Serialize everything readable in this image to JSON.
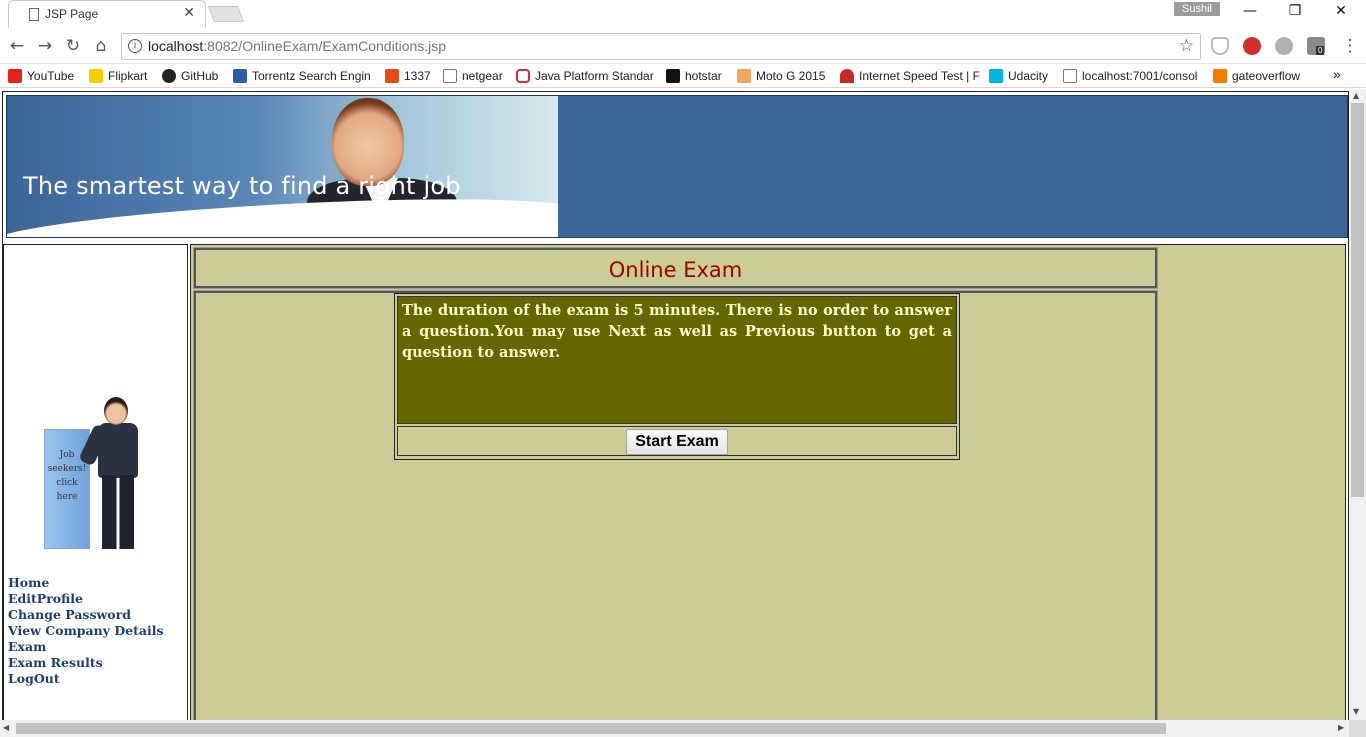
{
  "browser": {
    "tab_title": "JSP Page",
    "tab_close": "✕",
    "user_name": "Sushil",
    "url_host": "localhost",
    "url_rest": ":8082/OnlineExam/ExamConditions.jsp",
    "info_glyph": "i",
    "star_glyph": "☆",
    "window_controls": {
      "minimize": "—",
      "restore": "❐",
      "close": "✕"
    },
    "nav": {
      "back": "←",
      "forward": "→",
      "reload": "↻",
      "home": "⌂",
      "menu": "⋮"
    },
    "extensions": [
      "shield-icon",
      "adblock-icon",
      "extension-icon",
      "extension-badge-icon"
    ],
    "extension_badge": "0",
    "bookmarks_more": "»"
  },
  "bookmarks": [
    {
      "label": "YouTube",
      "color": "#e62117"
    },
    {
      "label": "Flipkart",
      "color": "#f7d000"
    },
    {
      "label": "GitHub",
      "color": "#222222"
    },
    {
      "label": "Torrentz Search Engin",
      "color": "#2a5ca8"
    },
    {
      "label": "1337",
      "color": "#e64a19"
    },
    {
      "label": "netgear",
      "color": "#888888"
    },
    {
      "label": "Java Platform Standar",
      "color": "#d32f2f"
    },
    {
      "label": "hotstar",
      "color": "#111111"
    },
    {
      "label": "Moto G 2015",
      "color": "#f2a65a"
    },
    {
      "label": "Internet Speed Test | F",
      "color": "#c62828"
    },
    {
      "label": "Udacity",
      "color": "#02b3e4"
    },
    {
      "label": "localhost:7001/consol",
      "color": "#888888"
    },
    {
      "label": "gateoverflow",
      "color": "#f57c00"
    }
  ],
  "banner": {
    "tagline": "The smartest way to find a right job",
    "bg_color": "#3c6598"
  },
  "sidebar": {
    "ad_text": "Job seekers! click here",
    "links": [
      "Home",
      "EditProfile",
      "Change Password",
      "View Company Details",
      "Exam",
      "Exam Results",
      "LogOut"
    ]
  },
  "main": {
    "title": "Online Exam",
    "conditions": "The duration of the exam is 5 minutes. There is no order to answer a question.You may use Next as well as Previous button to get a question to answer.",
    "start_button": "Start Exam",
    "colors": {
      "page_bg": "#cccc99",
      "box_bg": "#666600",
      "box_text": "#ffffcc",
      "title": "#990000",
      "links": "#1c3f73"
    }
  },
  "scroll": {
    "up": "▲",
    "down": "▼",
    "left": "◀",
    "right": "▶"
  }
}
